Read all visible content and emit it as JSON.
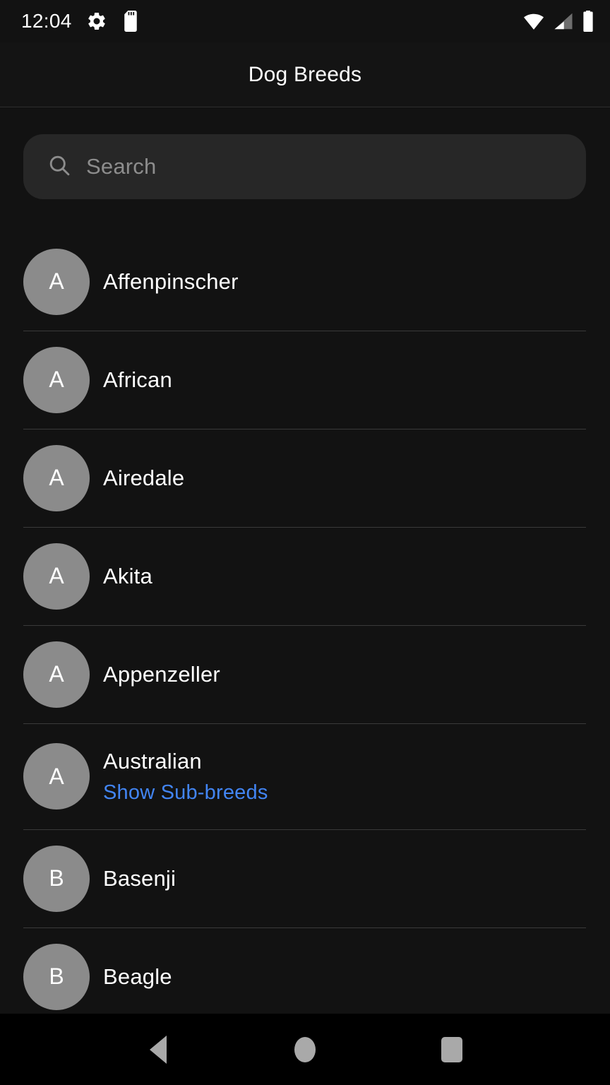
{
  "status_bar": {
    "time": "12:04",
    "left_icons": [
      "gear-icon",
      "sd-card-icon"
    ],
    "right_icons": [
      "wifi-icon",
      "cellular-signal-icon",
      "battery-icon"
    ]
  },
  "app_bar": {
    "title": "Dog Breeds"
  },
  "search": {
    "placeholder": "Search",
    "value": "",
    "icon": "search-icon"
  },
  "colors": {
    "background": "#121212",
    "app_bar": "#141414",
    "search_field": "#272727",
    "avatar": "#8b8b8b",
    "divider": "#3a3a3a",
    "text_primary": "#ffffff",
    "text_placeholder": "#8d8d8d",
    "link_blue": "#4285f4",
    "nav_bar": "#000000",
    "nav_icon": "#a9a9a9"
  },
  "breeds": [
    {
      "initial": "A",
      "name": "Affenpinscher",
      "sub_link": null
    },
    {
      "initial": "A",
      "name": "African",
      "sub_link": null
    },
    {
      "initial": "A",
      "name": "Airedale",
      "sub_link": null
    },
    {
      "initial": "A",
      "name": "Akita",
      "sub_link": null
    },
    {
      "initial": "A",
      "name": "Appenzeller",
      "sub_link": null
    },
    {
      "initial": "A",
      "name": "Australian",
      "sub_link": "Show Sub-breeds"
    },
    {
      "initial": "B",
      "name": "Basenji",
      "sub_link": null
    },
    {
      "initial": "B",
      "name": "Beagle",
      "sub_link": null
    }
  ],
  "nav_bar": {
    "back_label": "Back",
    "home_label": "Home",
    "recents_label": "Recents"
  }
}
